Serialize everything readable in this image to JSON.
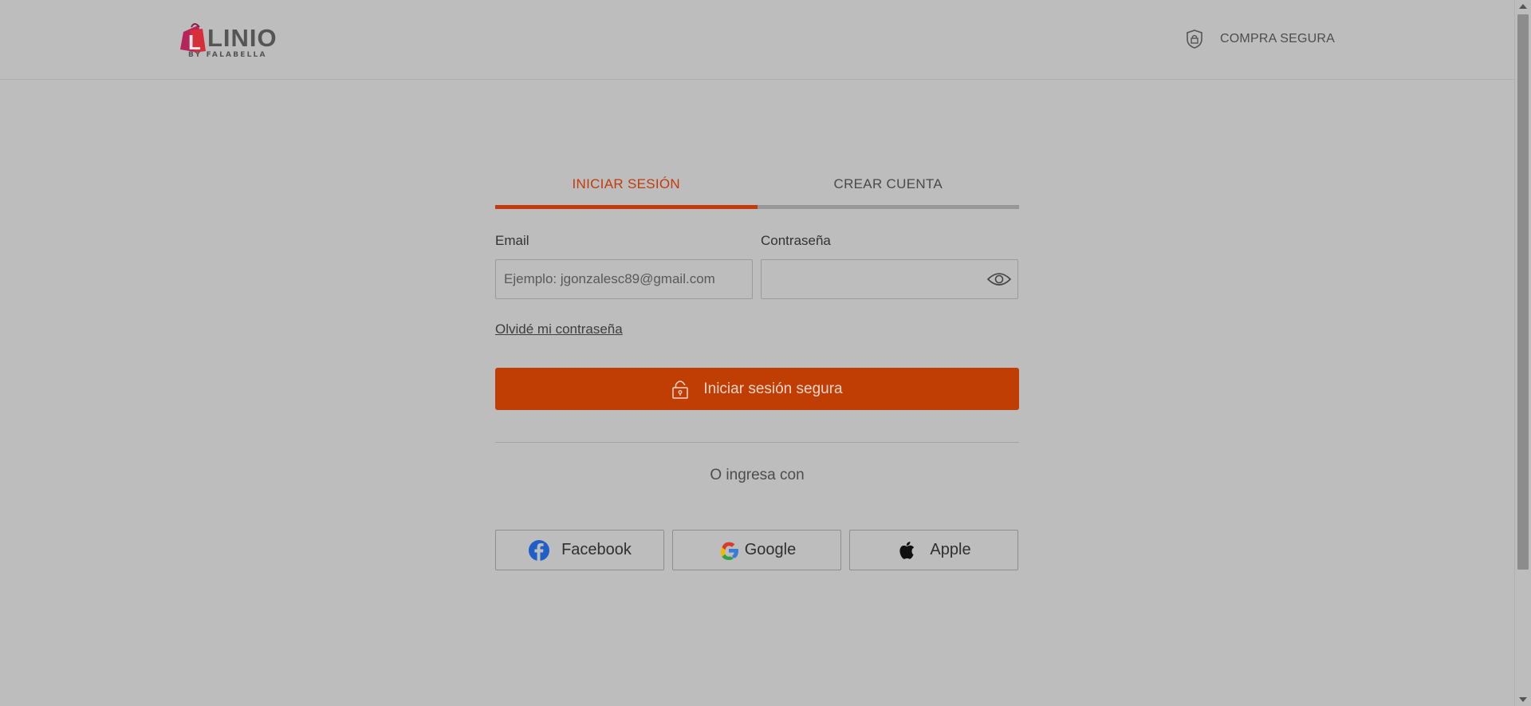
{
  "header": {
    "logo_text": "LINIO",
    "logo_sub": "BY FALABELLA",
    "secure_label": "COMPRA SEGURA"
  },
  "tabs": [
    {
      "label": "INICIAR SESIÓN",
      "active": true
    },
    {
      "label": "CREAR CUENTA",
      "active": false
    }
  ],
  "form": {
    "email_label": "Email",
    "email_value": "",
    "email_placeholder": "Ejemplo: jgonzalesc89@gmail.com",
    "password_label": "Contraseña",
    "password_value": "",
    "forgot_label": "Olvidé mi contraseña",
    "login_button_label": "Iniciar sesión segura",
    "or_text": "O ingresa con"
  },
  "socials": [
    {
      "label": "Facebook",
      "icon": "facebook-icon"
    },
    {
      "label": "Google",
      "icon": "google-icon"
    },
    {
      "label": "Apple",
      "icon": "apple-icon"
    }
  ],
  "colors": {
    "accent": "#c23b0c",
    "button_bg": "#c03e04",
    "page_bg": "#bdbdbd"
  }
}
